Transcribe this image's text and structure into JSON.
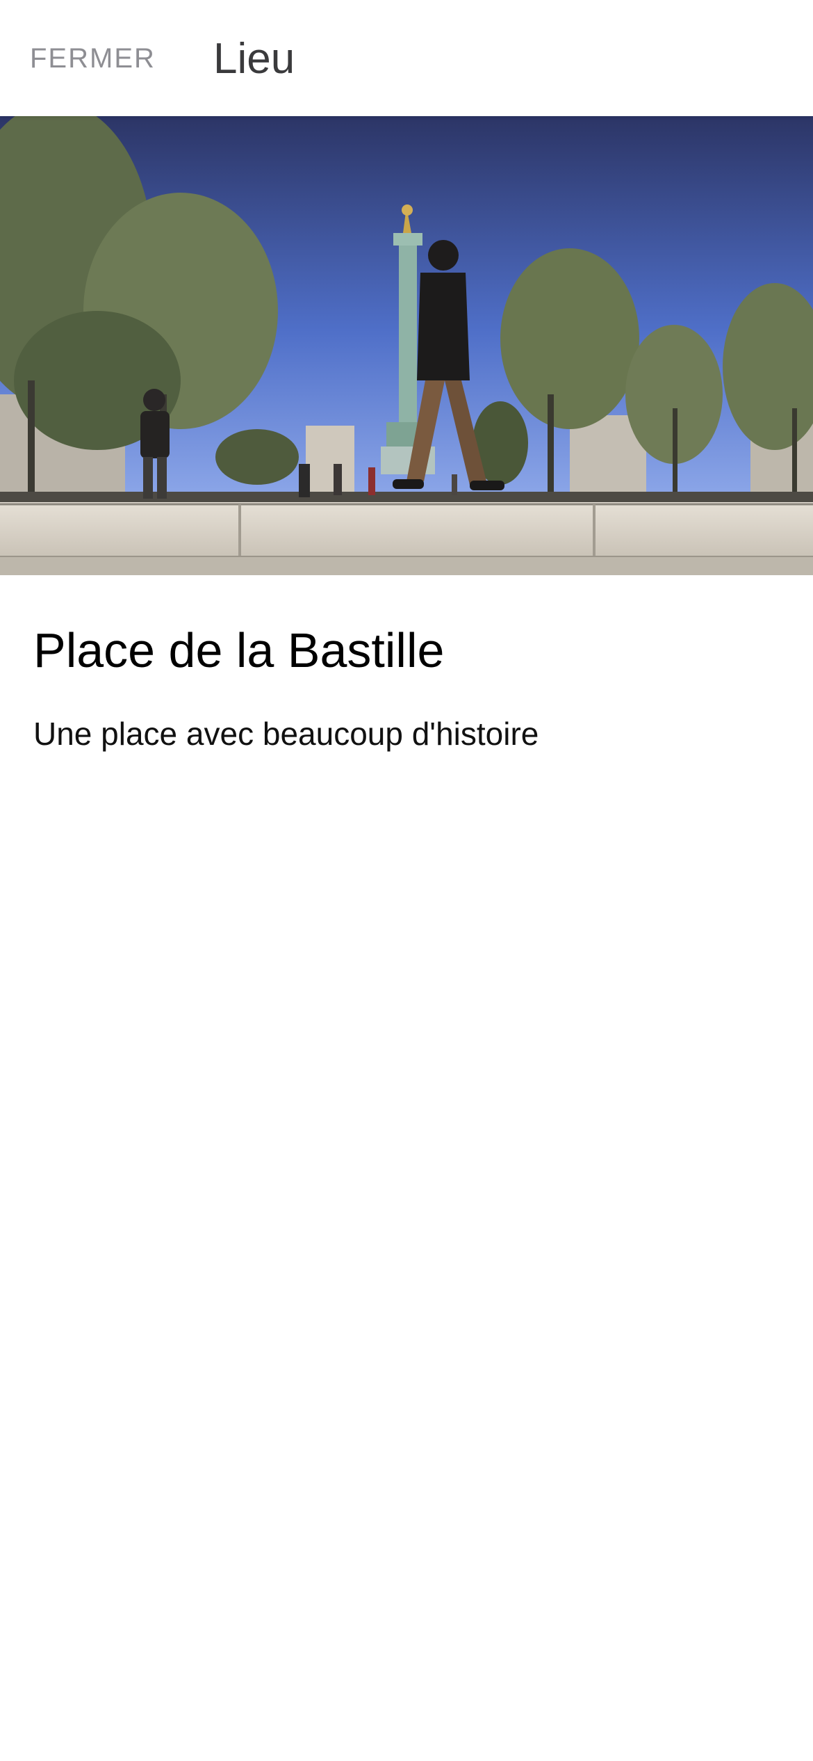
{
  "header": {
    "close_label": "FERMER",
    "title": "Lieu"
  },
  "hero_image": {
    "icon": "photo-place-de-la-bastille",
    "colors": {
      "sky_top": "#2c3566",
      "sky_bottom": "#7f9fe8",
      "tree": "#5d6b4c",
      "ledge": "#dcd6cb",
      "column": "#8fb3a6"
    }
  },
  "place": {
    "name": "Place de la Bastille",
    "description": "Une place avec beaucoup d'histoire"
  }
}
